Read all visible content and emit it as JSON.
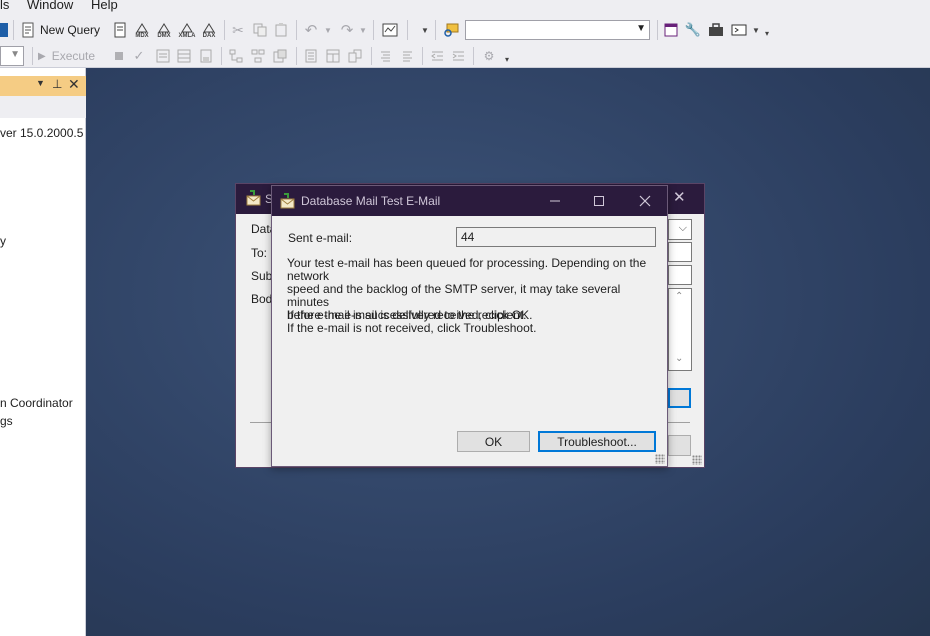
{
  "menu": {
    "left_fragment": "ls",
    "window": "Window",
    "help": "Help"
  },
  "toolbar": {
    "new_query": "New Query",
    "execute": "Execute",
    "mdx": "MDX",
    "dmx": "DMX",
    "xmla": "XMLA",
    "dax": "DAX"
  },
  "object_explorer": {
    "server_fragment": "ver 15.0.2000.5 -",
    "item_query": "y",
    "item_coordinator": "n Coordinator",
    "item_logs": "gs"
  },
  "back_dialog": {
    "title_fragment": "S",
    "labels": {
      "data": "Data",
      "to": "To:",
      "subject": "Subj",
      "body": "Body"
    }
  },
  "dialog": {
    "title": "Database Mail Test E-Mail",
    "sent_label": "Sent e-mail:",
    "sent_value": "44",
    "message_lines": [
      "Your test e-mail has been queued for processing.  Depending on the network",
      "speed and the backlog of the SMTP server, it may take several minutes",
      "before the e-mail is delivered to the recipient."
    ],
    "instruction_lines": [
      "If the e-mail is successfully received, click OK.",
      "If the e-mail is not received, click Troubleshoot."
    ],
    "ok_label": "OK",
    "troubleshoot_label": "Troubleshoot..."
  },
  "colors": {
    "title_bar": "#2b1b3d",
    "workspace": "#2e4163",
    "explorer_header": "#f5cc84",
    "focus_border": "#0078d7"
  }
}
